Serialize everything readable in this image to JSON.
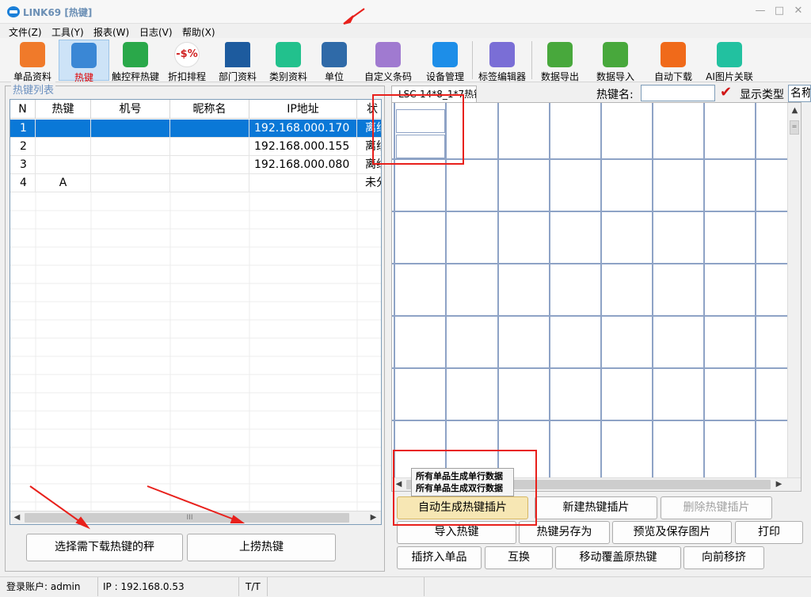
{
  "window": {
    "title": "LINK69 [热键]",
    "controls": [
      "minimize",
      "maximize",
      "close"
    ]
  },
  "menu": [
    {
      "label": "文件(Z)"
    },
    {
      "label": "工具(Y)"
    },
    {
      "label": "报表(W)"
    },
    {
      "label": "日志(V)"
    },
    {
      "label": "帮助(X)"
    }
  ],
  "toolbar": [
    {
      "label": "单品资料",
      "icon": "plu-icon",
      "color": "#f07a2a"
    },
    {
      "label": "热键",
      "icon": "keyboard-icon",
      "color": "#3a87d5",
      "active": true
    },
    {
      "label": "触控秤热键",
      "icon": "touch-scale-icon",
      "color": "#2aa84a"
    },
    {
      "label": "折扣排程",
      "icon": "discount-icon",
      "color": "#ffffff"
    },
    {
      "label": "部门资料",
      "icon": "department-icon",
      "color": "#1d5b9e"
    },
    {
      "label": "类别资料",
      "icon": "category-icon",
      "color": "#22c18d"
    },
    {
      "label": "单位",
      "icon": "unit-icon",
      "color": "#2f6aa8"
    },
    {
      "label": "自定义条码",
      "icon": "barcode-icon",
      "color": "#a07ad0"
    },
    {
      "label": "设备管理",
      "icon": "device-icon",
      "color": "#1d8ee8"
    },
    {
      "label": "标签编辑器",
      "icon": "label-editor-icon",
      "color": "#7a6ed6"
    },
    {
      "label": "数据导出",
      "icon": "export-icon",
      "color": "#48a83c"
    },
    {
      "label": "数据导入",
      "icon": "import-icon",
      "color": "#48a83c"
    },
    {
      "label": "自动下载",
      "icon": "timer-icon",
      "color": "#f06a1a"
    },
    {
      "label": "AI图片关联",
      "icon": "ai-image-icon",
      "color": "#22c1a0"
    }
  ],
  "hotkey_list": {
    "group_title": "热键列表",
    "columns": [
      "N",
      "热键",
      "机号",
      "昵称名",
      "IP地址",
      "状"
    ],
    "rows": [
      {
        "n": "1",
        "hotkey": "",
        "machine": "",
        "nickname": "",
        "ip": "192.168.000.170",
        "status": "离线",
        "selected": true
      },
      {
        "n": "2",
        "hotkey": "",
        "machine": "",
        "nickname": "",
        "ip": "192.168.000.155",
        "status": "离线"
      },
      {
        "n": "3",
        "hotkey": "",
        "machine": "",
        "nickname": "",
        "ip": "192.168.000.080",
        "status": "离线"
      },
      {
        "n": "4",
        "hotkey": "A",
        "machine": "",
        "nickname": "",
        "ip": "",
        "status": "未分"
      }
    ],
    "scroll_grip": "III"
  },
  "left_buttons": {
    "select_scale": "选择需下载热键的秤",
    "upload_hotkey": "上捞热键"
  },
  "right_panel": {
    "tab_label": "LSC-14*8_1*7热键",
    "hotkey_name_label": "热键名:",
    "hotkey_name_value": "",
    "display_type_label": "显示类型",
    "display_type_value": "名称",
    "scroll_grip": "="
  },
  "tooltip": {
    "line1": "所有单品生成单行数据",
    "line2": "所有单品生成双行数据"
  },
  "action_buttons": {
    "auto_generate": "自动生成热键插片",
    "new_insert": "新建热键插片",
    "delete_insert": "删除热键插片",
    "import_hotkey": "导入热键",
    "save_as": "热键另存为",
    "preview_save": "预览及保存图片",
    "print": "打印",
    "insert_item": "插挤入单品",
    "swap": "互换",
    "move_overwrite": "移动覆盖原热键",
    "move_forward": "向前移挤"
  },
  "status": {
    "account": "登录账户: admin",
    "ip": "IP : 192.168.0.53",
    "tt": "T/T"
  },
  "colors": {
    "selected_row": "#0a78d7",
    "annotation_red": "#e8201b",
    "link_blue": "#6a8fbf"
  }
}
